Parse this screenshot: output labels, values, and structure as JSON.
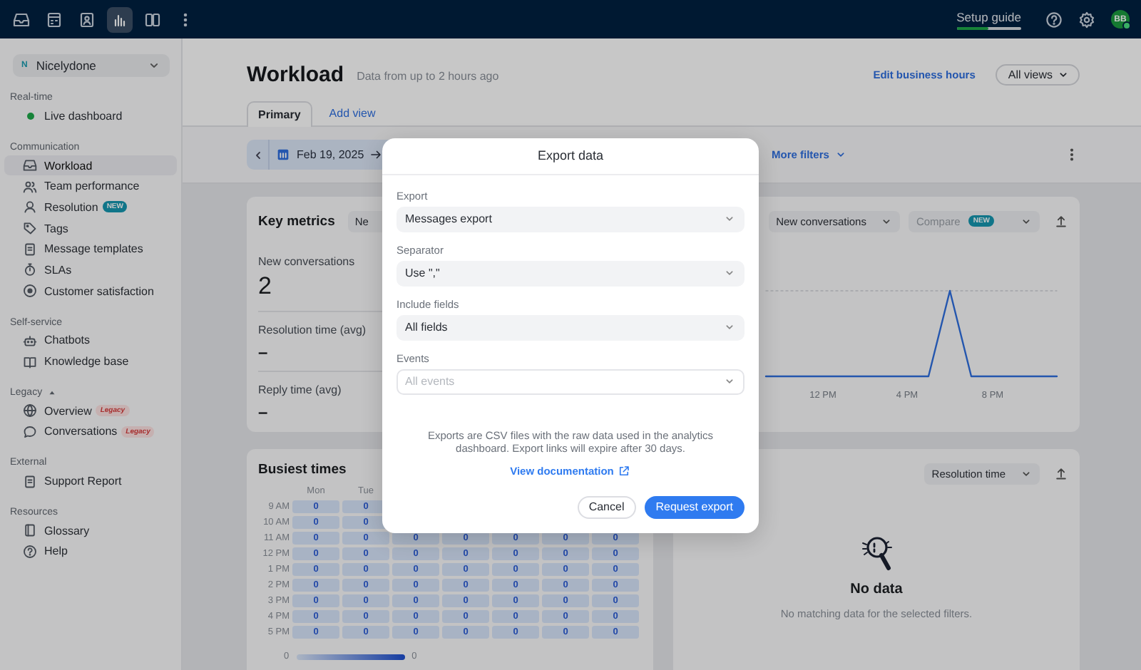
{
  "top_bar": {
    "apps": [
      {
        "selected": false
      },
      {
        "selected": false
      },
      {
        "selected": false
      },
      {
        "selected": true
      },
      {
        "selected": false
      }
    ],
    "setup_guide": {
      "label": "Setup guide",
      "level": 0.5
    },
    "avatar": {
      "initials": "BB"
    }
  },
  "sidebar": {
    "workspace": {
      "initial": "N",
      "name": "Nicelydone"
    },
    "sections": [
      {
        "title": "Real-time",
        "items": [
          {
            "label": "Live dashboard",
            "kind": "status",
            "selected": false
          }
        ]
      },
      {
        "title": "Communication",
        "items": [
          {
            "label": "Workload",
            "kind": "link",
            "selected": true
          },
          {
            "label": "Team performance",
            "kind": "link",
            "selected": false
          },
          {
            "label": "Resolution",
            "kind": "link",
            "selected": false,
            "badge": {
              "text": "NEW",
              "kind": "new"
            }
          },
          {
            "label": "Tags",
            "kind": "link",
            "selected": false
          },
          {
            "label": "Message templates",
            "kind": "link",
            "selected": false
          },
          {
            "label": "SLAs",
            "kind": "link",
            "selected": false
          },
          {
            "label": "Customer satisfaction",
            "kind": "link",
            "selected": false
          }
        ]
      },
      {
        "title": "Self-service",
        "items": [
          {
            "label": "Chatbots",
            "kind": "link",
            "selected": false
          },
          {
            "label": "Knowledge base",
            "kind": "link",
            "selected": false
          }
        ]
      },
      {
        "title": "Legacy",
        "expanded": true,
        "items": [
          {
            "label": "Overview",
            "kind": "link",
            "selected": false,
            "badge": {
              "text": "Legacy",
              "kind": "legacy"
            }
          },
          {
            "label": "Conversations",
            "kind": "link",
            "selected": false,
            "badge": {
              "text": "Legacy",
              "kind": "legacy"
            }
          }
        ]
      },
      {
        "title": "External",
        "items": [
          {
            "label": "Support Report",
            "kind": "link",
            "selected": false
          }
        ]
      },
      {
        "title": "Resources",
        "items": [
          {
            "label": "Glossary",
            "kind": "link",
            "selected": false
          },
          {
            "label": "Help",
            "kind": "link",
            "selected": false
          }
        ]
      }
    ]
  },
  "header": {
    "title": "Workload",
    "subtitle": "Data from up to 2 hours ago",
    "link": "Edit business hours",
    "views_button": "All views"
  },
  "tabs": [
    {
      "label": "Primary",
      "selected": true
    }
  ],
  "add_view_link": "Add view",
  "filters": {
    "date": "Feb 19, 2025",
    "more_filters": "More filters"
  },
  "metrics_card": {
    "title": "Key metrics",
    "selector": "Ne",
    "metrics": [
      {
        "label": "New conversations",
        "value": "2"
      },
      {
        "label": "Resolution time (avg)",
        "value": "–"
      },
      {
        "label": "Reply time (avg)",
        "value": "–"
      }
    ],
    "chart": {
      "metric_select": "New conversations",
      "compare": {
        "label": "Compare",
        "badge": "NEW",
        "disabled": true
      },
      "x_labels": [
        "12 PM",
        "4 PM",
        "8 PM"
      ]
    }
  },
  "busiest_card": {
    "title": "Busiest times",
    "columns": [
      "Mon",
      "Tue"
    ],
    "rows": [
      {
        "label": "9 AM",
        "cells": [
          "0",
          "0"
        ]
      },
      {
        "label": "10 AM",
        "cells": [
          "0",
          "0"
        ]
      },
      {
        "label": "11 AM",
        "cells": [
          "0",
          "0",
          "0",
          "0",
          "0",
          "0",
          "0"
        ]
      },
      {
        "label": "12 PM",
        "cells": [
          "0",
          "0",
          "0",
          "0",
          "0",
          "0",
          "0"
        ]
      },
      {
        "label": "1 PM",
        "cells": [
          "0",
          "0",
          "0",
          "0",
          "0",
          "0",
          "0"
        ]
      },
      {
        "label": "2 PM",
        "cells": [
          "0",
          "0",
          "0",
          "0",
          "0",
          "0",
          "0"
        ]
      },
      {
        "label": "3 PM",
        "cells": [
          "0",
          "0",
          "0",
          "0",
          "0",
          "0",
          "0"
        ]
      },
      {
        "label": "4 PM",
        "cells": [
          "0",
          "0",
          "0",
          "0",
          "0",
          "0",
          "0"
        ]
      },
      {
        "label": "5 PM",
        "cells": [
          "0",
          "0",
          "0",
          "0",
          "0",
          "0",
          "0"
        ]
      }
    ],
    "legend": {
      "min": "0",
      "max": "0"
    }
  },
  "resolution_card": {
    "select": "Resolution time",
    "empty_title": "No data",
    "empty_text": "No matching data for the selected filters."
  },
  "dialog": {
    "title": "Export data",
    "fields": [
      {
        "label": "Export",
        "value": "Messages export",
        "disabled": false
      },
      {
        "label": "Separator",
        "value": "Use \",\"",
        "disabled": false
      },
      {
        "label": "Include fields",
        "value": "All fields",
        "disabled": false
      },
      {
        "label": "Events",
        "placeholder": "All events",
        "disabled": true
      }
    ],
    "note": "Exports are CSV files with the raw data used in the analytics dashboard. Export links will expire after 30 days.",
    "doc_link": "View documentation",
    "buttons": [
      {
        "label": "Cancel",
        "kind": "secondary"
      },
      {
        "label": "Request export",
        "kind": "primary"
      }
    ]
  }
}
